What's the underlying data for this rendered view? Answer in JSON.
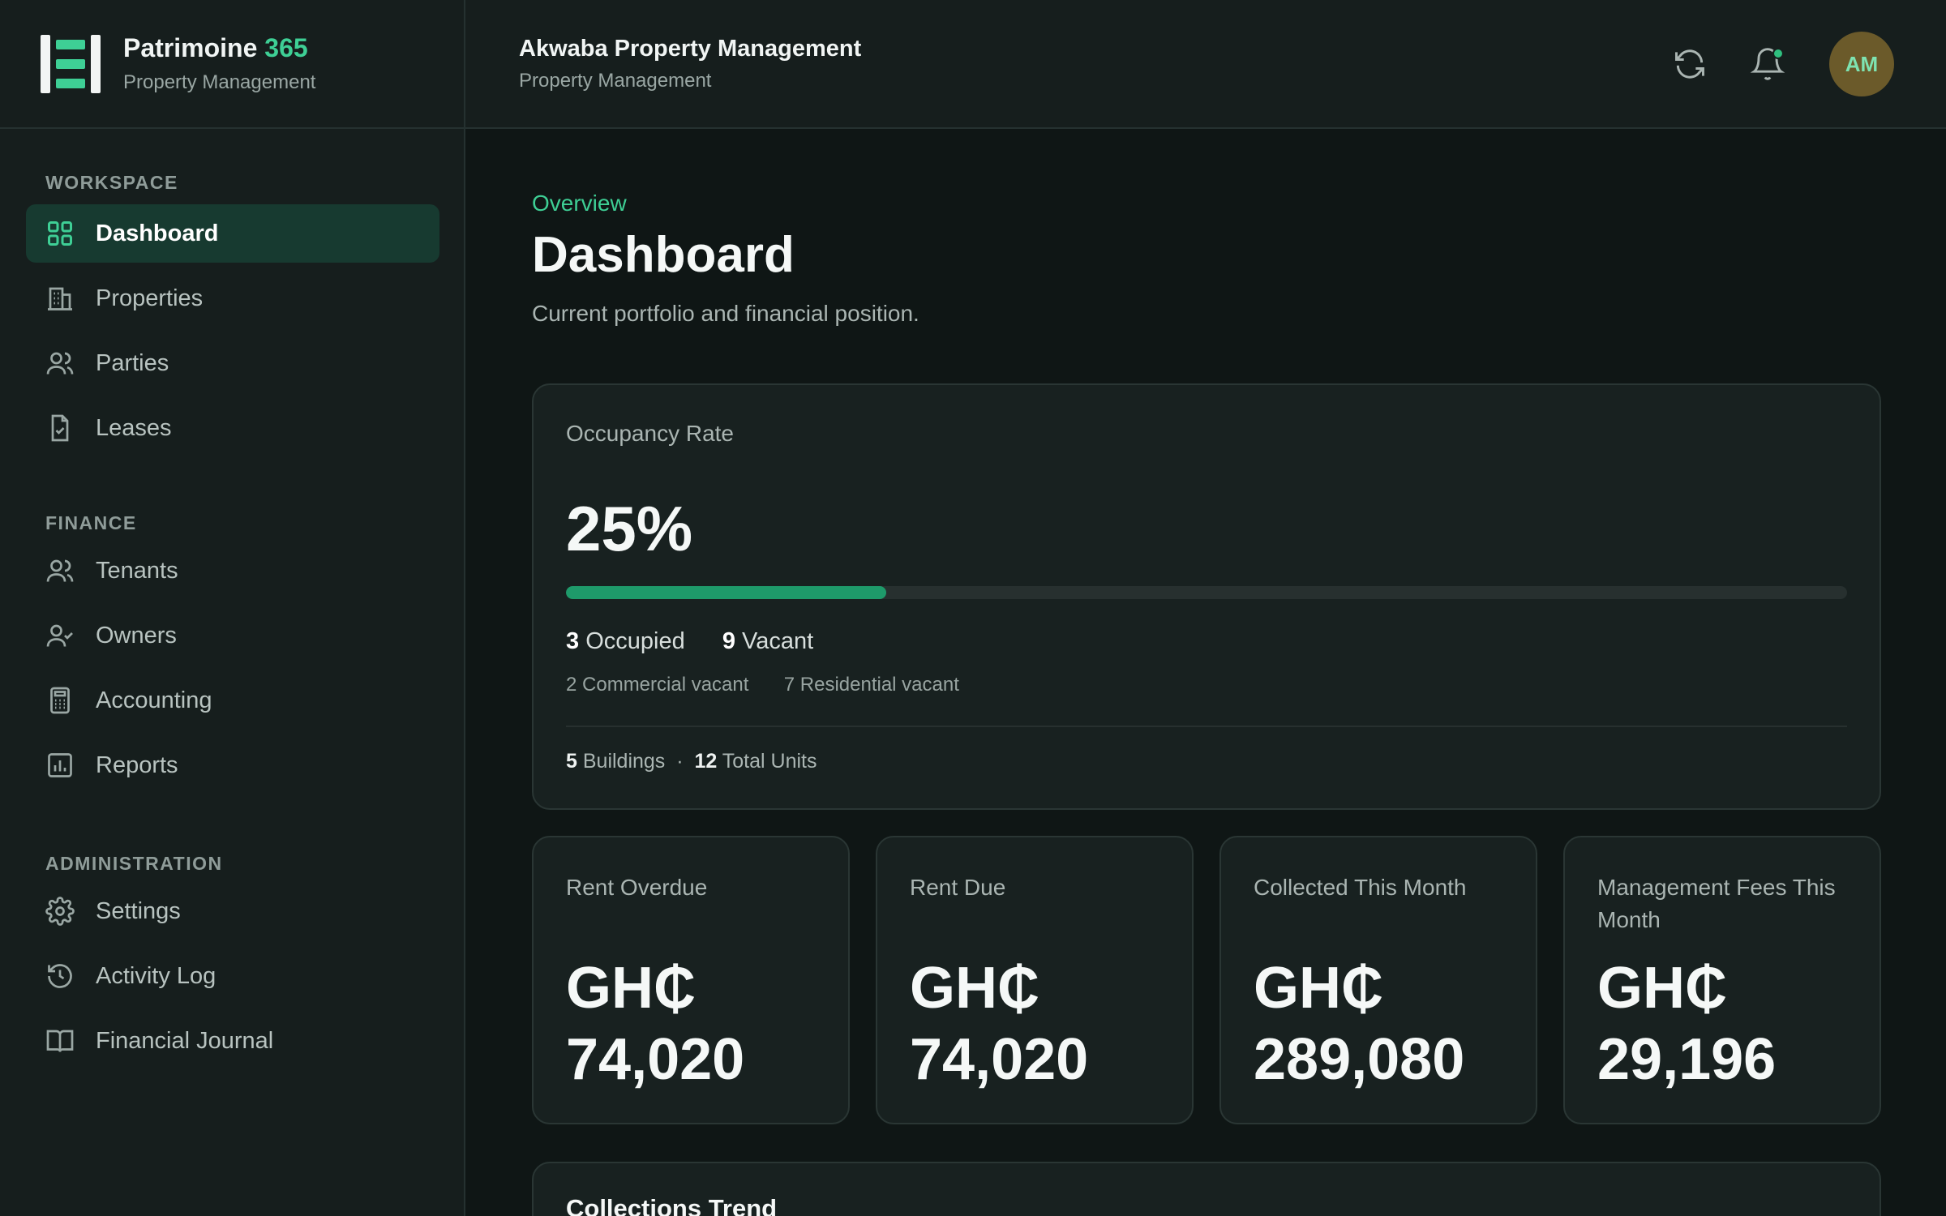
{
  "brand": {
    "name": "Patrimoine",
    "name_accent": "365",
    "subtitle": "Property Management"
  },
  "header": {
    "org_name": "Akwaba Property Management",
    "org_subtitle": "Property Management",
    "avatar_initials": "AM",
    "icons": [
      "refresh-icon",
      "bell-icon"
    ]
  },
  "sidebar": {
    "sections": [
      {
        "title": "WORKSPACE",
        "items": [
          {
            "label": "Dashboard",
            "icon": "grid-icon",
            "active": true
          },
          {
            "label": "Properties",
            "icon": "building-icon"
          },
          {
            "label": "Parties",
            "icon": "users-icon"
          },
          {
            "label": "Leases",
            "icon": "file-check-icon"
          }
        ]
      },
      {
        "title": "FINANCE",
        "items": [
          {
            "label": "Tenants",
            "icon": "users-icon"
          },
          {
            "label": "Owners",
            "icon": "user-check-icon"
          },
          {
            "label": "Accounting",
            "icon": "calculator-icon"
          },
          {
            "label": "Reports",
            "icon": "bar-chart-icon"
          }
        ]
      },
      {
        "title": "ADMINISTRATION",
        "items": [
          {
            "label": "Settings",
            "icon": "gear-icon"
          },
          {
            "label": "Activity Log",
            "icon": "history-icon"
          },
          {
            "label": "Financial Journal",
            "icon": "book-icon"
          }
        ]
      }
    ]
  },
  "main": {
    "eyebrow": "Overview",
    "title": "Dashboard",
    "subtitle": "Current portfolio and financial position.",
    "occupancy": {
      "label": "Occupancy Rate",
      "rate": "25%",
      "rate_percent": 25,
      "occupied_count": "3",
      "occupied_label": "Occupied",
      "vacant_count": "9",
      "vacant_label": "Vacant",
      "commercial_vacant": "2 Commercial vacant",
      "residential_vacant": "7 Residential vacant",
      "buildings_count": "5",
      "buildings_label": "Buildings",
      "separator": "·",
      "units_count": "12",
      "units_label": "Total Units"
    },
    "stats": [
      {
        "label": "Rent Overdue",
        "currency": "GH₵",
        "amount": "74,020"
      },
      {
        "label": "Rent Due",
        "currency": "GH₵",
        "amount": "74,020"
      },
      {
        "label": "Collected This Month",
        "currency": "GH₵",
        "amount": "289,080"
      },
      {
        "label": "Management Fees This Month",
        "currency": "GH₵",
        "amount": "29,196"
      }
    ],
    "trend_title": "Collections Trend"
  },
  "colors": {
    "accent": "#3ecf95",
    "progress_fill": "#1e9a6a",
    "active_nav_bg": "#173a30",
    "avatar_bg": "#6b5a2a"
  }
}
